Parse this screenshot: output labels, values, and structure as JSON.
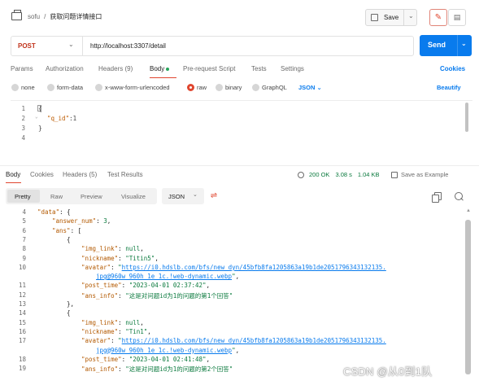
{
  "header": {
    "collection": "sofu",
    "separator": "/",
    "request_name": "获取问题详情接口",
    "save_label": "Save",
    "edit_icon": "pencil-icon",
    "comment_icon": "comment-icon"
  },
  "request": {
    "method": "POST",
    "url": "http://localhost:3307/detail",
    "send_label": "Send"
  },
  "request_tabs": [
    {
      "label": "Params"
    },
    {
      "label": "Authorization"
    },
    {
      "label": "Headers (9)"
    },
    {
      "label": "Body"
    },
    {
      "label": "Pre-request Script"
    },
    {
      "label": "Tests"
    },
    {
      "label": "Settings"
    }
  ],
  "cookies_label": "Cookies",
  "body_types": [
    {
      "label": "none"
    },
    {
      "label": "form-data"
    },
    {
      "label": "x-www-form-urlencoded"
    },
    {
      "label": "raw",
      "selected": true
    },
    {
      "label": "binary"
    },
    {
      "label": "GraphQL"
    }
  ],
  "raw_format": "JSON",
  "beautify_label": "Beautify",
  "request_body": {
    "line_numbers": [
      "1",
      "2",
      "3",
      "4"
    ],
    "line1": "{",
    "key": "\"q_id\"",
    "rest": ":1",
    "line3": "}"
  },
  "response_tabs": [
    {
      "label": "Body"
    },
    {
      "label": "Cookies"
    },
    {
      "label": "Headers (5)"
    },
    {
      "label": "Test Results"
    }
  ],
  "response_meta": {
    "status": "200 OK",
    "time": "3.08 s",
    "size": "1.04 KB",
    "save_example": "Save as Example"
  },
  "response_format_tabs": [
    {
      "label": "Pretty"
    },
    {
      "label": "Raw"
    },
    {
      "label": "Preview"
    },
    {
      "label": "Visualize"
    }
  ],
  "response_format": "JSON",
  "response_lines": [
    {
      "n": "4",
      "indent": 1,
      "parts": [
        [
          "k",
          "\"data\""
        ],
        [
          "p",
          ": {"
        ]
      ]
    },
    {
      "n": "5",
      "indent": 2,
      "parts": [
        [
          "k",
          "\"answer_num\""
        ],
        [
          "p",
          ": "
        ],
        [
          "n",
          "3"
        ],
        [
          "p",
          ","
        ]
      ]
    },
    {
      "n": "6",
      "indent": 2,
      "parts": [
        [
          "k",
          "\"ans\""
        ],
        [
          "p",
          ": ["
        ]
      ]
    },
    {
      "n": "7",
      "indent": 3,
      "parts": [
        [
          "p",
          "{"
        ]
      ]
    },
    {
      "n": "8",
      "indent": 4,
      "parts": [
        [
          "k",
          "\"img_link\""
        ],
        [
          "p",
          ": "
        ],
        [
          "nl",
          "null"
        ],
        [
          "p",
          ","
        ]
      ]
    },
    {
      "n": "9",
      "indent": 4,
      "parts": [
        [
          "k",
          "\"nickname\""
        ],
        [
          "p",
          ": "
        ],
        [
          "s",
          "\"Titin5\""
        ],
        [
          "p",
          ","
        ]
      ]
    },
    {
      "n": "10",
      "indent": 4,
      "parts": [
        [
          "k",
          "\"avatar\""
        ],
        [
          "p",
          ": "
        ],
        [
          "s",
          "\""
        ],
        [
          "u",
          "https://i0.hdslb.com/bfs/new_dyn/45bfb8fa1205863a19b1de2051796343132135."
        ]
      ]
    },
    {
      "n": "",
      "indent": 5,
      "parts": [
        [
          "u",
          "jpg@960w_960h_1e_1c.!web-dynamic.webp"
        ],
        [
          "s",
          "\""
        ],
        [
          "p",
          ","
        ]
      ]
    },
    {
      "n": "11",
      "indent": 4,
      "parts": [
        [
          "k",
          "\"post_time\""
        ],
        [
          "p",
          ": "
        ],
        [
          "s",
          "\"2023-04-01 02:37:42\""
        ],
        [
          "p",
          ","
        ]
      ]
    },
    {
      "n": "12",
      "indent": 4,
      "parts": [
        [
          "k",
          "\"ans_info\""
        ],
        [
          "p",
          ": "
        ],
        [
          "s",
          "\"这是对问题id为1的问题的第1个回答\""
        ]
      ]
    },
    {
      "n": "13",
      "indent": 3,
      "parts": [
        [
          "p",
          "},"
        ]
      ]
    },
    {
      "n": "14",
      "indent": 3,
      "parts": [
        [
          "p",
          "{"
        ]
      ]
    },
    {
      "n": "15",
      "indent": 4,
      "parts": [
        [
          "k",
          "\"img_link\""
        ],
        [
          "p",
          ": "
        ],
        [
          "nl",
          "null"
        ],
        [
          "p",
          ","
        ]
      ]
    },
    {
      "n": "16",
      "indent": 4,
      "parts": [
        [
          "k",
          "\"nickname\""
        ],
        [
          "p",
          ": "
        ],
        [
          "s",
          "\"Tin1\""
        ],
        [
          "p",
          ","
        ]
      ]
    },
    {
      "n": "17",
      "indent": 4,
      "parts": [
        [
          "k",
          "\"avatar\""
        ],
        [
          "p",
          ": "
        ],
        [
          "s",
          "\""
        ],
        [
          "u",
          "https://i0.hdslb.com/bfs/new_dyn/45bfb8fa1205863a19b1de2051796343132135."
        ]
      ]
    },
    {
      "n": "",
      "indent": 5,
      "parts": [
        [
          "u",
          "jpg@960w_960h_1e_1c.!web-dynamic.webp"
        ],
        [
          "s",
          "\""
        ],
        [
          "p",
          ","
        ]
      ]
    },
    {
      "n": "18",
      "indent": 4,
      "parts": [
        [
          "k",
          "\"post_time\""
        ],
        [
          "p",
          ": "
        ],
        [
          "s",
          "\"2023-04-01 02:41:48\""
        ],
        [
          "p",
          ","
        ]
      ]
    },
    {
      "n": "19",
      "indent": 4,
      "parts": [
        [
          "k",
          "\"ans_info\""
        ],
        [
          "p",
          ": "
        ],
        [
          "s",
          "\"这是对问题id为1的问题的第2个回答\""
        ]
      ]
    }
  ],
  "watermark": "CSDN @从0到1队"
}
